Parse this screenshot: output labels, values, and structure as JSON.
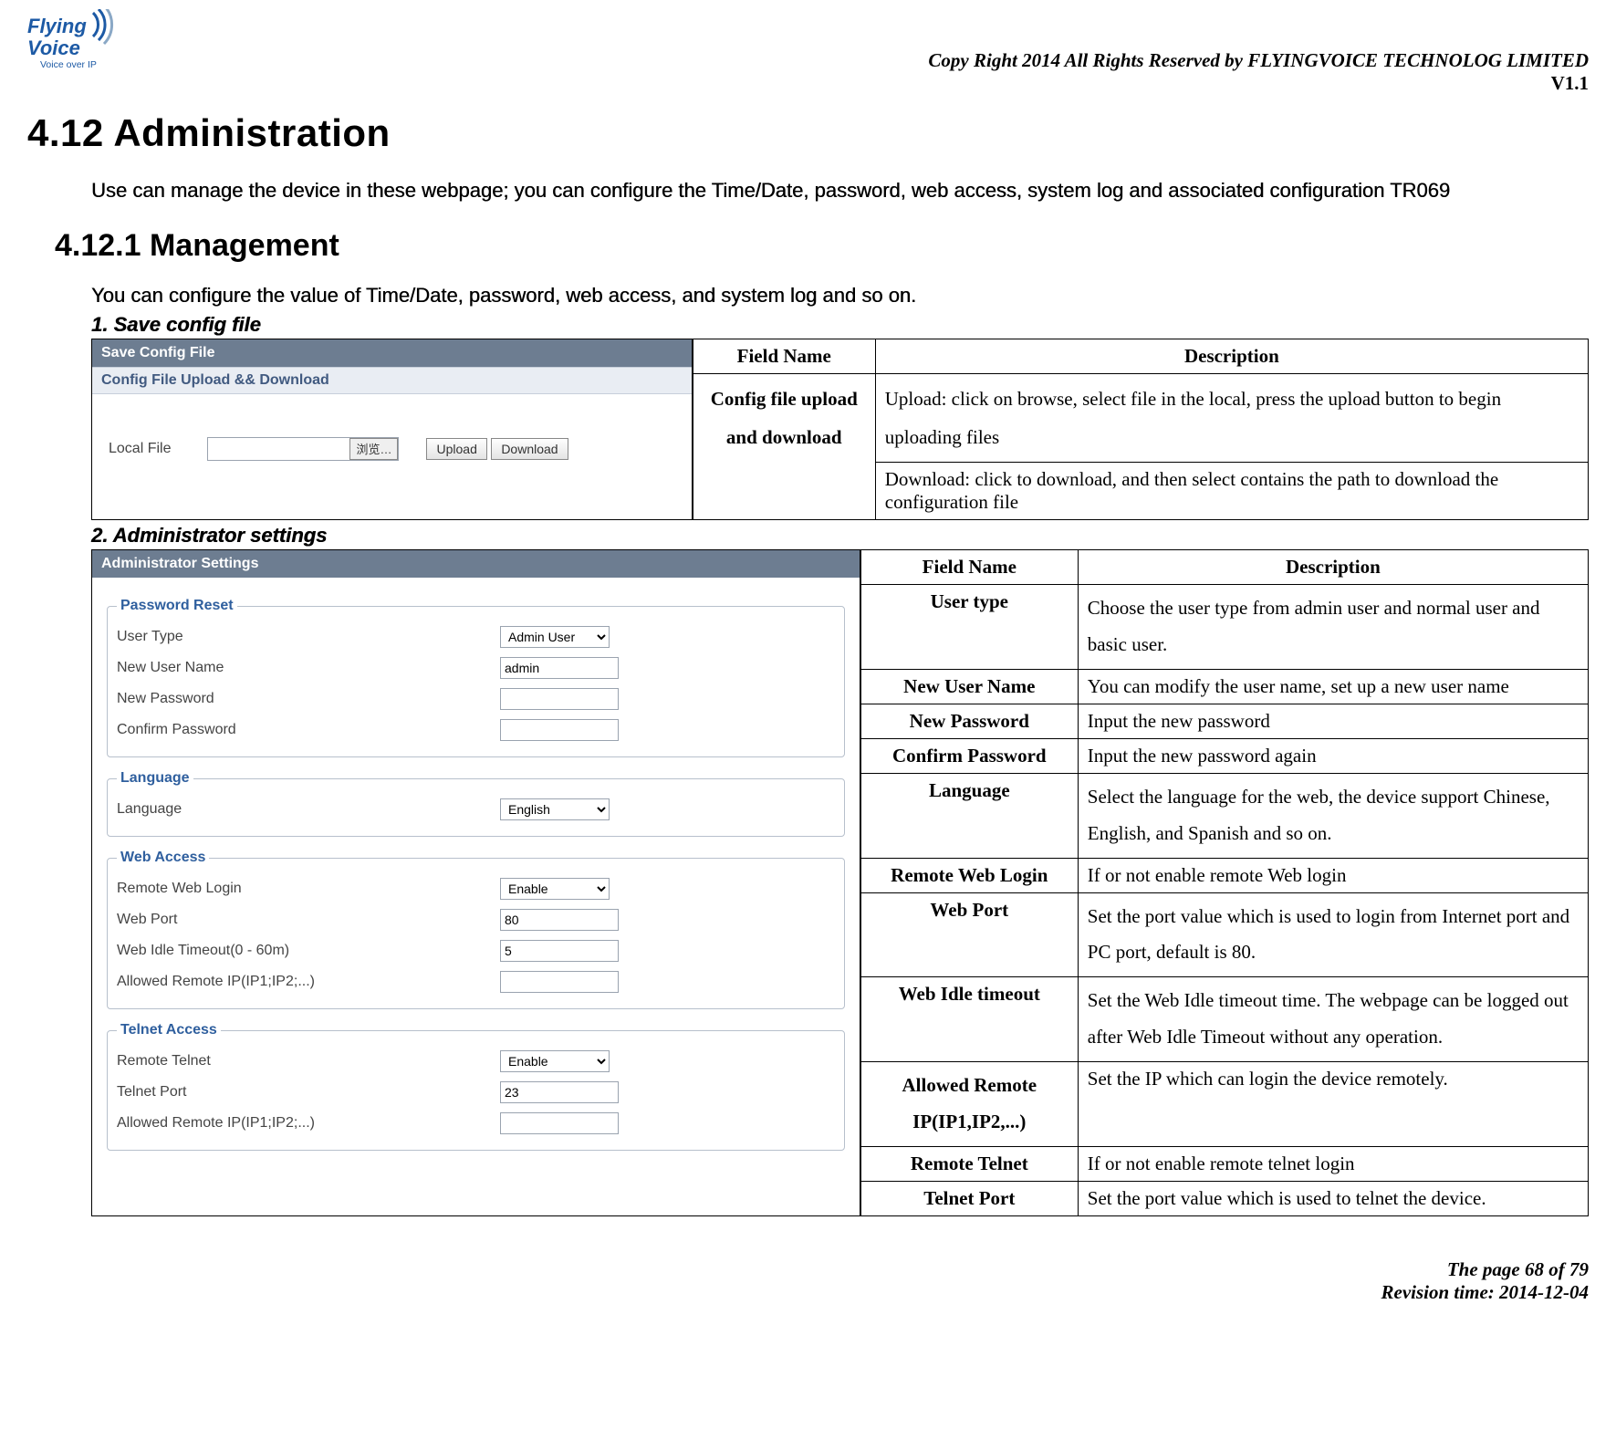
{
  "header": {
    "logo_main": "FlyingVoice",
    "logo_tag": "Voice over IP",
    "copyright": "Copy Right 2014 All Rights Reserved by FLYINGVOICE TECHNOLOG LIMITED",
    "version": "V1.1"
  },
  "section": {
    "title": "4.12 Administration",
    "intro": "Use can manage the device in these webpage; you can configure the Time/Date, password, web access, system log and associated configuration TR069",
    "sub_title": "4.12.1  Management",
    "config_line": "You can configure the value of Time/Date, password, web access, and system log and so on.",
    "item1": "1.  Save config file",
    "item2": "2.  Administrator settings"
  },
  "shot1": {
    "bar1": "Save Config File",
    "bar2": "Config File Upload && Download",
    "local_file_label": "Local File",
    "browse": "浏览…",
    "upload": "Upload",
    "download": "Download"
  },
  "table1": {
    "h1": "Field Name",
    "h2": "Description",
    "r1c1": "Config file upload and download",
    "r1c2": "Upload: click on browse, select file in the local, press the upload button to begin uploading files",
    "r2c2": "Download: click to download, and then select contains the path to download the configuration file"
  },
  "shot2": {
    "bar1": "Administrator Settings",
    "fs1": {
      "legend": "Password Reset",
      "user_type_label": "User Type",
      "user_type_value": "Admin User",
      "new_user_label": "New User Name",
      "new_user_value": "admin",
      "new_pw_label": "New Password",
      "new_pw_value": "",
      "confirm_pw_label": "Confirm Password",
      "confirm_pw_value": ""
    },
    "fs2": {
      "legend": "Language",
      "language_label": "Language",
      "language_value": "English"
    },
    "fs3": {
      "legend": "Web Access",
      "remote_web_label": "Remote Web Login",
      "remote_web_value": "Enable",
      "web_port_label": "Web Port",
      "web_port_value": "80",
      "idle_label": "Web Idle Timeout(0 - 60m)",
      "idle_value": "5",
      "allowed_ip_label": "Allowed Remote IP(IP1;IP2;...)",
      "allowed_ip_value": ""
    },
    "fs4": {
      "legend": "Telnet Access",
      "remote_telnet_label": "Remote Telnet",
      "remote_telnet_value": "Enable",
      "telnet_port_label": "Telnet Port",
      "telnet_port_value": "23",
      "allowed_ip_label": "Allowed Remote IP(IP1;IP2;...)",
      "allowed_ip_value": ""
    }
  },
  "table2": {
    "h1": "Field Name",
    "h2": "Description",
    "rows": [
      {
        "name": "User type",
        "desc": "Choose the user type from admin user and normal user and basic user."
      },
      {
        "name": "New User Name",
        "desc": "You can modify the user name, set up a new user name"
      },
      {
        "name": "New Password",
        "desc": "Input the new password"
      },
      {
        "name": "Confirm Password",
        "desc": "Input the new password again"
      },
      {
        "name": "Language",
        "desc": "Select the language for the web, the device support Chinese, English, and Spanish and so on."
      },
      {
        "name": "Remote Web Login",
        "desc": "If or not enable remote Web login"
      },
      {
        "name": "Web Port",
        "desc": "Set the port value which is used to login from Internet port and PC port, default is 80."
      },
      {
        "name": "Web Idle timeout",
        "desc": "Set the Web Idle timeout time. The webpage can be logged out after Web Idle Timeout without any operation."
      },
      {
        "name": "Allowed Remote IP(IP1,IP2,...)",
        "desc": "Set the IP which can login the device remotely."
      },
      {
        "name": "Remote Telnet",
        "desc": "If or not enable remote telnet login"
      },
      {
        "name": "Telnet Port",
        "desc": "Set the port value which is used to telnet the device."
      }
    ]
  },
  "footer": {
    "page": "The page 68 of 79",
    "rev": "Revision time: 2014-12-04"
  }
}
